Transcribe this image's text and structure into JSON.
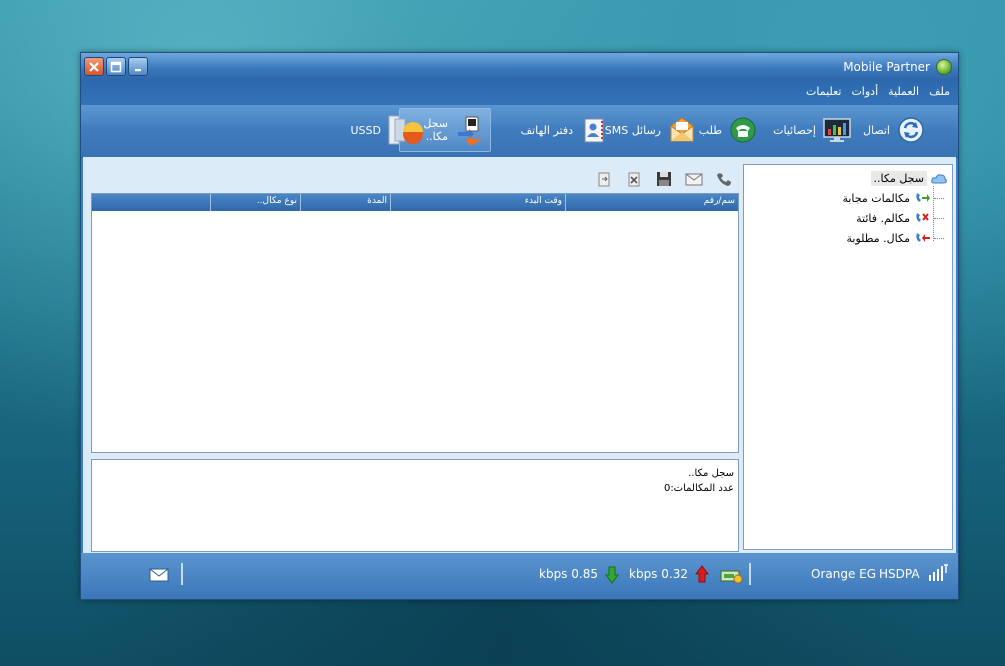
{
  "window": {
    "title": "Mobile Partner"
  },
  "menu": [
    "ملف",
    "العملية",
    "أدوات",
    "تعليمات"
  ],
  "toolbar": {
    "items": [
      {
        "label": "اتصال",
        "icon": "connect-icon"
      },
      {
        "label": "إحصائيات",
        "icon": "statistics-icon"
      },
      {
        "label": "طلب",
        "icon": "dial-icon"
      },
      {
        "label": "رسائل SMS",
        "icon": "sms-icon"
      },
      {
        "label": "دفتر الهاتف",
        "icon": "phonebook-icon"
      },
      {
        "label": "سجل مكا..",
        "icon": "call-log-icon",
        "active": true
      },
      {
        "label": "USSD",
        "icon": "ussd-icon"
      }
    ]
  },
  "tree": {
    "root": "سجل مكا..",
    "children": [
      "مكالمات مجابة",
      "مكالم. فائتة",
      "مكال. مطلوبة"
    ]
  },
  "table": {
    "columns": [
      "سم/رقم",
      "وقت البدء",
      "المدة",
      "نوع مكال.."
    ]
  },
  "info": {
    "title": "سجل مكا..",
    "count_line": "عدد المكالمات:0"
  },
  "status": {
    "network": "Orange EG",
    "mode": "HSDPA",
    "upload": "kbps 0.32",
    "download": "kbps 0.85"
  },
  "colors": {
    "accent": "#3d7fbf",
    "download_arrow": "#2fa82f",
    "upload_arrow": "#d91d1d"
  }
}
